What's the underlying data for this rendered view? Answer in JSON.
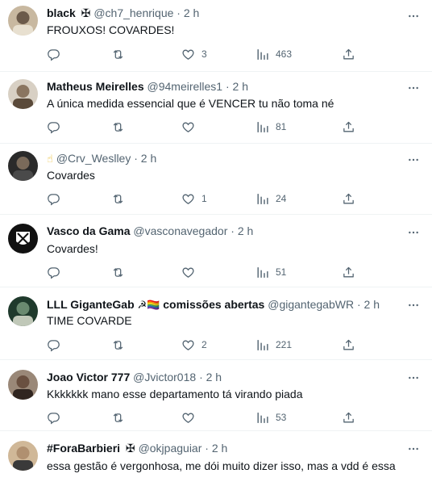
{
  "tweets": [
    {
      "name": "black",
      "badge": "✠",
      "handle": "@ch7_henrique",
      "dot": "·",
      "time": "2 h",
      "text": "FROUXOS! COVARDES!",
      "likes": "3",
      "views": "463",
      "avatar_color": "#6b5a4a"
    },
    {
      "name": "Matheus Meirelles",
      "badge": "",
      "handle": "@94meirelles1",
      "dot": "·",
      "time": "2 h",
      "text": "A única medida essencial que é VENCER tu não toma né",
      "likes": "",
      "views": "81",
      "avatar_color": "#8a7560"
    },
    {
      "name": "",
      "emoji": "☝",
      "handle": "@Crv_Weslley",
      "dot": "·",
      "time": "2 h",
      "text": "Covardes",
      "likes": "1",
      "views": "24",
      "avatar_color": "#3a3a3a"
    },
    {
      "name": "Vasco da Gama",
      "badge": "",
      "handle": "@vasconavegador",
      "dot": "·",
      "time": "2 h",
      "text": "Covardes!",
      "likes": "",
      "views": "51",
      "avatar_color": "#111111"
    },
    {
      "name": "LLL GiganteGab",
      "flags": "☭🏳️‍🌈",
      "extra": "comissões abertas",
      "handle": "@gigantegabWR",
      "dot": "·",
      "time": "2 h",
      "text": "TIME COVARDE",
      "likes": "2",
      "views": "221",
      "avatar_color": "#2e4a3a"
    },
    {
      "name": "Joao Victor 777",
      "badge": "",
      "handle": "@Jvictor018",
      "dot": "·",
      "time": "2 h",
      "text": "Kkkkkkk mano esse departamento tá virando piada",
      "likes": "",
      "views": "53",
      "avatar_color": "#7a6a5c"
    },
    {
      "name": "#ForaBarbieri",
      "badge": "✠",
      "handle": "@okjpaguiar",
      "dot": "·",
      "time": "2 h",
      "text": "essa gestão é vergonhosa, me dói muito dizer isso, mas a vdd é essa",
      "likes": "",
      "views": "",
      "avatar_color": "#b09070"
    }
  ],
  "colors": {
    "text_primary": "#0f1419",
    "text_secondary": "#536471",
    "divider": "#eff3f4"
  },
  "icons": [
    "reply-icon",
    "retweet-icon",
    "like-icon",
    "views-icon",
    "share-icon",
    "more-icon"
  ]
}
